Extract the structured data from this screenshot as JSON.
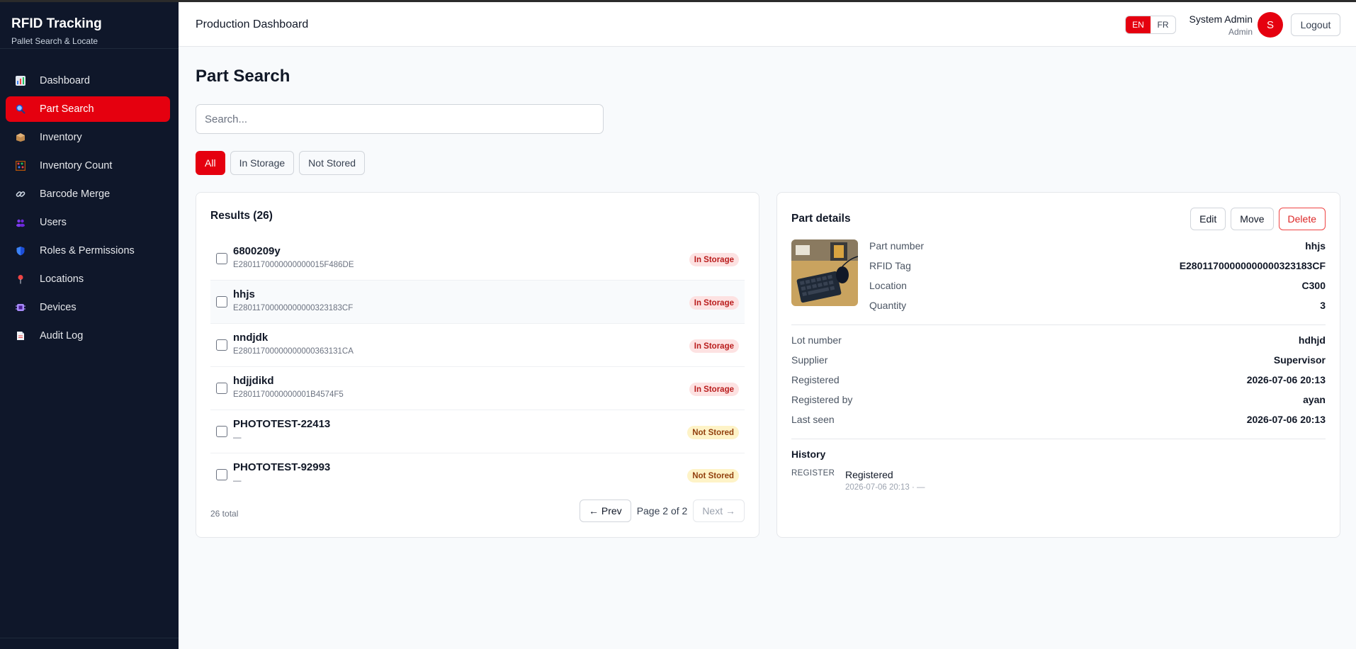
{
  "brand": {
    "title": "RFID Tracking",
    "subtitle": "Pallet Search & Locate"
  },
  "nav": [
    {
      "label": "Dashboard",
      "icon": "bar-chart-icon",
      "active": false
    },
    {
      "label": "Part Search",
      "icon": "magnifier-icon",
      "active": true
    },
    {
      "label": "Inventory",
      "icon": "package-icon",
      "active": false
    },
    {
      "label": "Inventory Count",
      "icon": "abacus-icon",
      "active": false
    },
    {
      "label": "Barcode Merge",
      "icon": "link-icon",
      "active": false
    },
    {
      "label": "Users",
      "icon": "users-icon",
      "active": false
    },
    {
      "label": "Roles & Permissions",
      "icon": "shield-icon",
      "active": false
    },
    {
      "label": "Locations",
      "icon": "pin-icon",
      "active": false
    },
    {
      "label": "Devices",
      "icon": "device-icon",
      "active": false
    },
    {
      "label": "Audit Log",
      "icon": "document-icon",
      "active": false
    }
  ],
  "header": {
    "title": "Production Dashboard",
    "lang_en": "EN",
    "lang_fr": "FR",
    "user_name": "System Admin",
    "user_role": "Admin",
    "avatar_initial": "S",
    "logout_label": "Logout"
  },
  "main": {
    "page_title": "Part Search",
    "search_placeholder": "Search...",
    "filters": {
      "all": "All",
      "in_storage": "In Storage",
      "not_stored": "Not Stored"
    }
  },
  "results": {
    "title": "Results (26)",
    "rows": [
      {
        "name": "6800209y",
        "tag": "E2801170000000000015F486DE",
        "status": "In Storage"
      },
      {
        "name": "hhjs",
        "tag": "E28011700000000000323183CF",
        "status": "In Storage"
      },
      {
        "name": "nndjdk",
        "tag": "E28011700000000000363131CA",
        "status": "In Storage"
      },
      {
        "name": "hdjjdikd",
        "tag": "E2801170000000001B4574F5",
        "status": "In Storage"
      },
      {
        "name": "PHOTOTEST-22413",
        "tag": "—",
        "status": "Not Stored"
      },
      {
        "name": "PHOTOTEST-92993",
        "tag": "—",
        "status": "Not Stored"
      }
    ],
    "total": "26 total",
    "prev_label": "← Prev",
    "page_info": "Page 2 of 2",
    "next_label": "Next →"
  },
  "details": {
    "title": "Part details",
    "edit_label": "Edit",
    "move_label": "Move",
    "delete_label": "Delete",
    "part_number_label": "Part number",
    "part_number": "hhjs",
    "rfid_label": "RFID Tag",
    "rfid": "E28011700000000000323183CF",
    "location_label": "Location",
    "location": "C300",
    "quantity_label": "Quantity",
    "quantity": "3",
    "lot_label": "Lot number",
    "lot": "hdhjd",
    "supplier_label": "Supplier",
    "supplier": "Supervisor",
    "registered_label": "Registered",
    "registered": "2026-07-06 20:13",
    "registered_by_label": "Registered by",
    "registered_by": "ayan",
    "last_seen_label": "Last seen",
    "last_seen": "2026-07-06 20:13",
    "history_title": "History",
    "history": [
      {
        "type": "REGISTER",
        "label": "Registered",
        "meta": "2026-07-06 20:13 · —"
      }
    ]
  },
  "colors": {
    "accent": "#e5000f",
    "sidebar": "#0f172a",
    "badge_stored_bg": "#fde2e2",
    "badge_notstored_bg": "#fef3c7"
  }
}
